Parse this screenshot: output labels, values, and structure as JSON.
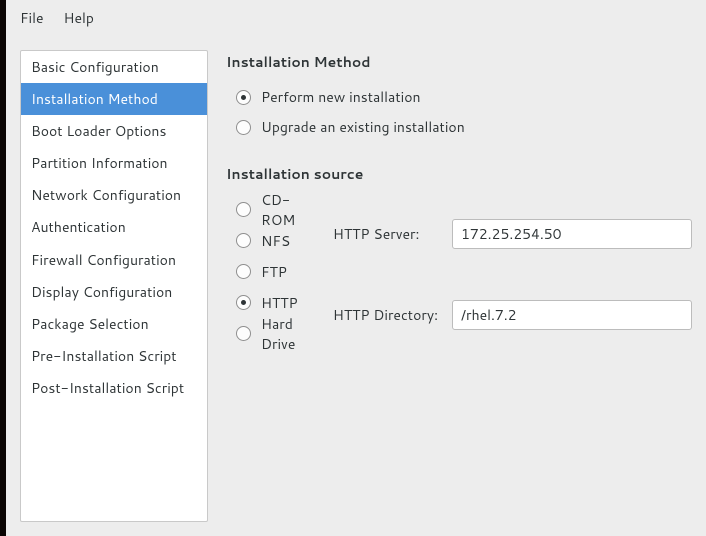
{
  "menubar": {
    "items": [
      "File",
      "Help"
    ]
  },
  "sidebar": {
    "items": [
      "Basic Configuration",
      "Installation Method",
      "Boot Loader Options",
      "Partition Information",
      "Network Configuration",
      "Authentication",
      "Firewall Configuration",
      "Display Configuration",
      "Package Selection",
      "Pre-Installation Script",
      "Post-Installation Script"
    ],
    "selected_index": 1
  },
  "main": {
    "section1_title": "Installation Method",
    "method_options": [
      "Perform new installation",
      "Upgrade an existing installation"
    ],
    "method_selected": 0,
    "section2_title": "Installation source",
    "source_options": [
      "CD-ROM",
      "NFS",
      "FTP",
      "HTTP",
      "Hard Drive"
    ],
    "source_selected": 3,
    "http_server_label": "HTTP Server:",
    "http_server_value": "172.25.254.50",
    "http_dir_label": "HTTP Directory:",
    "http_dir_value": "/rhel.7.2"
  }
}
